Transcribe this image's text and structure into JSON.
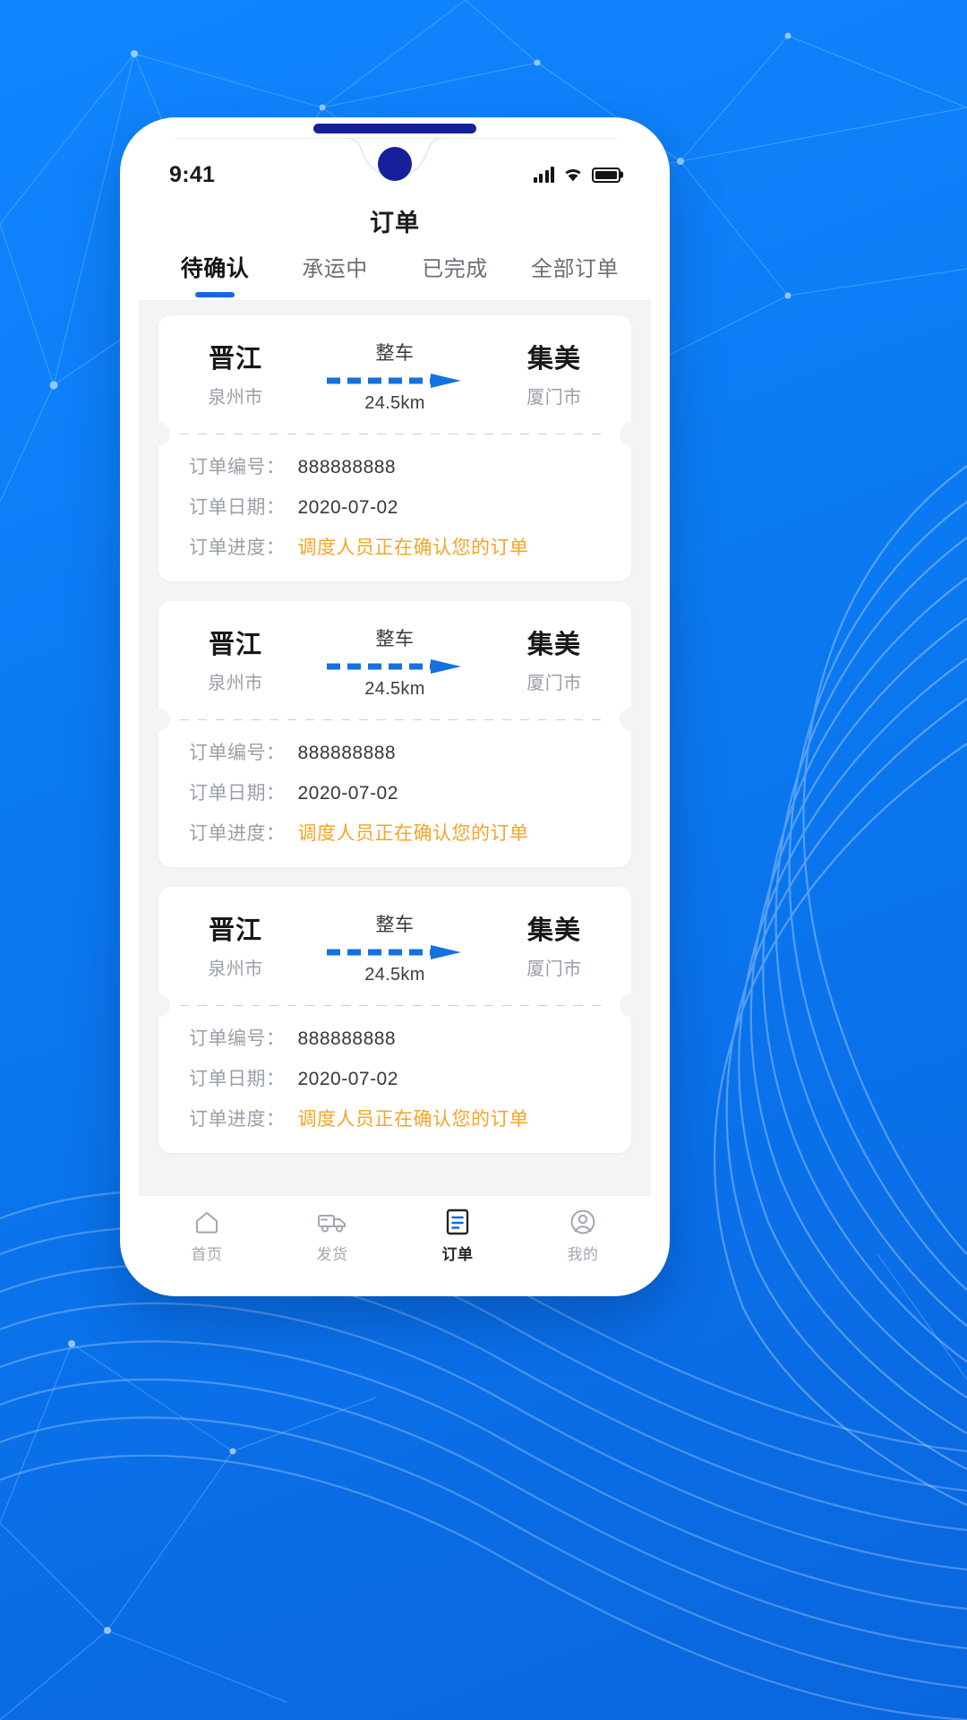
{
  "background": {
    "accent_blue": "#0a7cf5",
    "deep_blue": "#16209b",
    "style": "geometric-polygon-network-with-wave-curves"
  },
  "status_bar": {
    "time": "9:41",
    "signal_icon": "signal-bars-icon",
    "wifi_icon": "wifi-icon",
    "battery_icon": "battery-full-icon"
  },
  "header": {
    "title": "订单"
  },
  "tabs": [
    {
      "label": "待确认",
      "active": true
    },
    {
      "label": "承运中",
      "active": false
    },
    {
      "label": "已完成",
      "active": false
    },
    {
      "label": "全部订单",
      "active": false
    }
  ],
  "orders": [
    {
      "origin_city": "晋江",
      "origin_region": "泉州市",
      "destination_city": "集美",
      "destination_region": "厦门市",
      "transport_type": "整车",
      "distance": "24.5km",
      "order_no_label": "订单编号：",
      "order_no_value": "888888888",
      "order_date_label": "订单日期：",
      "order_date_value": "2020-07-02",
      "progress_label": "订单进度：",
      "progress_value": "调度人员正在确认您的订单",
      "progress_color": "#f5a524"
    },
    {
      "origin_city": "晋江",
      "origin_region": "泉州市",
      "destination_city": "集美",
      "destination_region": "厦门市",
      "transport_type": "整车",
      "distance": "24.5km",
      "order_no_label": "订单编号：",
      "order_no_value": "888888888",
      "order_date_label": "订单日期：",
      "order_date_value": "2020-07-02",
      "progress_label": "订单进度：",
      "progress_value": "调度人员正在确认您的订单",
      "progress_color": "#f5a524"
    },
    {
      "origin_city": "晋江",
      "origin_region": "泉州市",
      "destination_city": "集美",
      "destination_region": "厦门市",
      "transport_type": "整车",
      "distance": "24.5km",
      "order_no_label": "订单编号：",
      "order_no_value": "888888888",
      "order_date_label": "订单日期：",
      "order_date_value": "2020-07-02",
      "progress_label": "订单进度：",
      "progress_value": "调度人员正在确认您的订单",
      "progress_color": "#f5a524"
    }
  ],
  "bottom_nav": [
    {
      "label": "首页",
      "icon": "home-icon",
      "active": false
    },
    {
      "label": "发货",
      "icon": "truck-icon",
      "active": false
    },
    {
      "label": "订单",
      "icon": "order-list-icon",
      "active": true
    },
    {
      "label": "我的",
      "icon": "user-icon",
      "active": false
    }
  ]
}
